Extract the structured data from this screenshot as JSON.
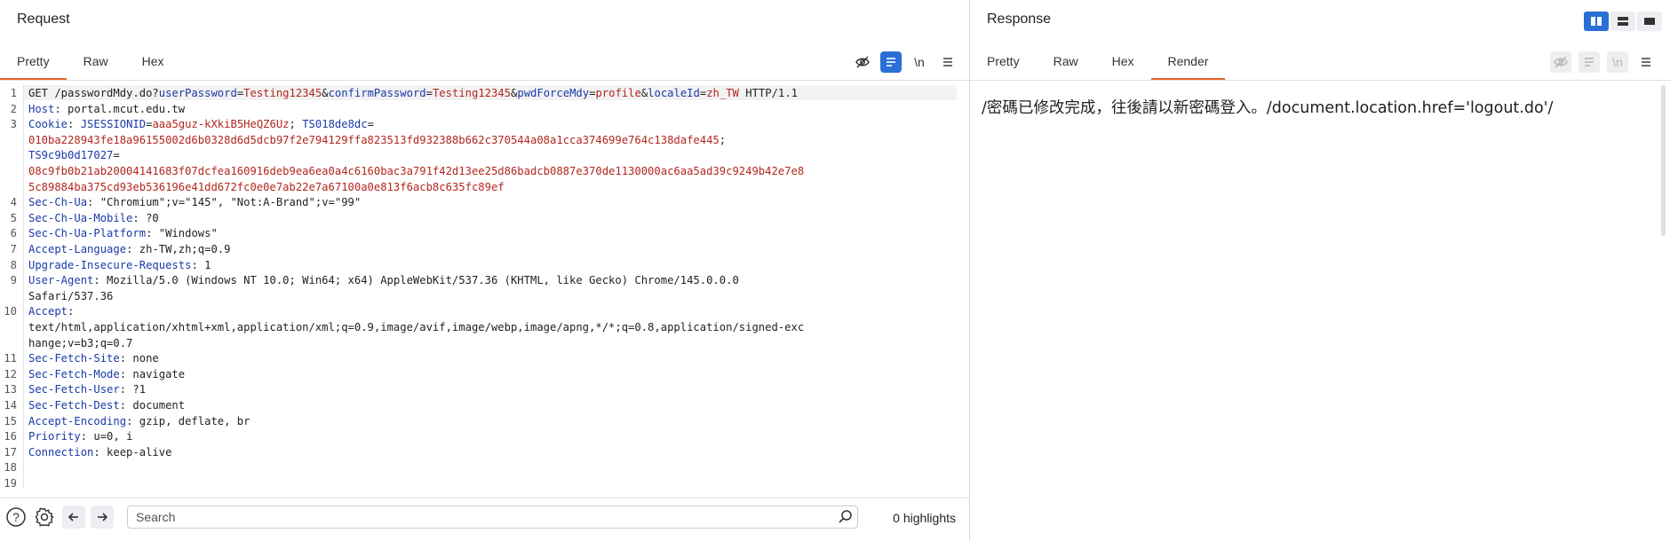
{
  "request": {
    "title": "Request",
    "tabs": [
      {
        "label": "Pretty",
        "active": true
      },
      {
        "label": "Raw",
        "active": false
      },
      {
        "label": "Hex",
        "active": false
      }
    ],
    "toolbar": {
      "newline_label": "\\n"
    },
    "lines": [
      {
        "n": "1",
        "segs": [
          [
            "p",
            "GET /passwordMdy.do?"
          ],
          [
            "k",
            "userPassword"
          ],
          [
            "p",
            "="
          ],
          [
            "v",
            "Testing12345"
          ],
          [
            "p",
            "&"
          ],
          [
            "k",
            "confirmPassword"
          ],
          [
            "p",
            "="
          ],
          [
            "v",
            "Testing12345"
          ],
          [
            "p",
            "&"
          ],
          [
            "k",
            "pwdForceMdy"
          ],
          [
            "p",
            "="
          ],
          [
            "v",
            "profile"
          ],
          [
            "p",
            "&"
          ],
          [
            "k",
            "localeId"
          ],
          [
            "p",
            "="
          ],
          [
            "v",
            "zh_TW"
          ],
          [
            "p",
            " HTTP/1.1"
          ]
        ]
      },
      {
        "n": "2",
        "segs": [
          [
            "k",
            "Host"
          ],
          [
            "p",
            ": portal.mcut.edu.tw"
          ]
        ]
      },
      {
        "n": "3",
        "segs": [
          [
            "k",
            "Cookie"
          ],
          [
            "p",
            ": "
          ],
          [
            "k",
            "JSESSIONID"
          ],
          [
            "p",
            "="
          ],
          [
            "v",
            "aaa5guz-kXkiB5HeQZ6Uz"
          ],
          [
            "p",
            "; "
          ],
          [
            "k",
            "TS018de8dc"
          ],
          [
            "p",
            "="
          ]
        ]
      },
      {
        "n": "",
        "segs": [
          [
            "v",
            "010ba228943fe18a96155002d6b0328d6d5dcb97f2e794129ffa823513fd932388b662c370544a08a1cca374699e764c138dafe445"
          ],
          [
            "p",
            ";"
          ]
        ]
      },
      {
        "n": "",
        "segs": [
          [
            "k",
            "TS9c9b0d17027"
          ],
          [
            "p",
            "="
          ]
        ]
      },
      {
        "n": "",
        "segs": [
          [
            "v",
            "08c9fb0b21ab20004141683f07dcfea160916deb9ea6ea0a4c6160bac3a791f42d13ee25d86badcb0887e370de1130000ac6aa5ad39c9249b42e7e8"
          ]
        ]
      },
      {
        "n": "",
        "segs": [
          [
            "v",
            "5c89884ba375cd93eb536196e41dd672fc0e0e7ab22e7a67100a0e813f6acb8c635fc89ef"
          ]
        ]
      },
      {
        "n": "4",
        "segs": [
          [
            "k",
            "Sec-Ch-Ua"
          ],
          [
            "p",
            ": \"Chromium\";v=\"145\", \"Not:A-Brand\";v=\"99\""
          ]
        ]
      },
      {
        "n": "5",
        "segs": [
          [
            "k",
            "Sec-Ch-Ua-Mobile"
          ],
          [
            "p",
            ": ?0"
          ]
        ]
      },
      {
        "n": "6",
        "segs": [
          [
            "k",
            "Sec-Ch-Ua-Platform"
          ],
          [
            "p",
            ": \"Windows\""
          ]
        ]
      },
      {
        "n": "7",
        "segs": [
          [
            "k",
            "Accept-Language"
          ],
          [
            "p",
            ": zh-TW,zh;q=0.9"
          ]
        ]
      },
      {
        "n": "8",
        "segs": [
          [
            "k",
            "Upgrade-Insecure-Requests"
          ],
          [
            "p",
            ": 1"
          ]
        ]
      },
      {
        "n": "9",
        "segs": [
          [
            "k",
            "User-Agent"
          ],
          [
            "p",
            ": Mozilla/5.0 (Windows NT 10.0; Win64; x64) AppleWebKit/537.36 (KHTML, like Gecko) Chrome/145.0.0.0"
          ]
        ]
      },
      {
        "n": "",
        "segs": [
          [
            "p",
            "Safari/537.36"
          ]
        ]
      },
      {
        "n": "10",
        "segs": [
          [
            "k",
            "Accept"
          ],
          [
            "p",
            ":"
          ]
        ]
      },
      {
        "n": "",
        "segs": [
          [
            "p",
            "text/html,application/xhtml+xml,application/xml;q=0.9,image/avif,image/webp,image/apng,*/*;q=0.8,application/signed-exc"
          ]
        ]
      },
      {
        "n": "",
        "segs": [
          [
            "p",
            "hange;v=b3;q=0.7"
          ]
        ]
      },
      {
        "n": "11",
        "segs": [
          [
            "k",
            "Sec-Fetch-Site"
          ],
          [
            "p",
            ": none"
          ]
        ]
      },
      {
        "n": "12",
        "segs": [
          [
            "k",
            "Sec-Fetch-Mode"
          ],
          [
            "p",
            ": navigate"
          ]
        ]
      },
      {
        "n": "13",
        "segs": [
          [
            "k",
            "Sec-Fetch-User"
          ],
          [
            "p",
            ": ?1"
          ]
        ]
      },
      {
        "n": "14",
        "segs": [
          [
            "k",
            "Sec-Fetch-Dest"
          ],
          [
            "p",
            ": document"
          ]
        ]
      },
      {
        "n": "15",
        "segs": [
          [
            "k",
            "Accept-Encoding"
          ],
          [
            "p",
            ": gzip, deflate, br"
          ]
        ]
      },
      {
        "n": "16",
        "segs": [
          [
            "k",
            "Priority"
          ],
          [
            "p",
            ": u=0, i"
          ]
        ]
      },
      {
        "n": "17",
        "segs": [
          [
            "k",
            "Connection"
          ],
          [
            "p",
            ": keep-alive"
          ]
        ]
      },
      {
        "n": "18",
        "segs": []
      },
      {
        "n": "19",
        "segs": []
      }
    ],
    "search": {
      "placeholder": "Search",
      "value": ""
    },
    "highlights": "0 highlights"
  },
  "response": {
    "title": "Response",
    "tabs": [
      {
        "label": "Pretty",
        "active": false
      },
      {
        "label": "Raw",
        "active": false
      },
      {
        "label": "Hex",
        "active": false
      },
      {
        "label": "Render",
        "active": true
      }
    ],
    "toolbar": {
      "newline_label": "\\n"
    },
    "render_text": "/密碼已修改完成，往後請以新密碼登入。/document.location.href='logout.do'/"
  },
  "colors": {
    "accent": "#e8642c",
    "key": "#1a3aa8",
    "value": "#b3261e",
    "toggle_active": "#2a6fd6"
  }
}
